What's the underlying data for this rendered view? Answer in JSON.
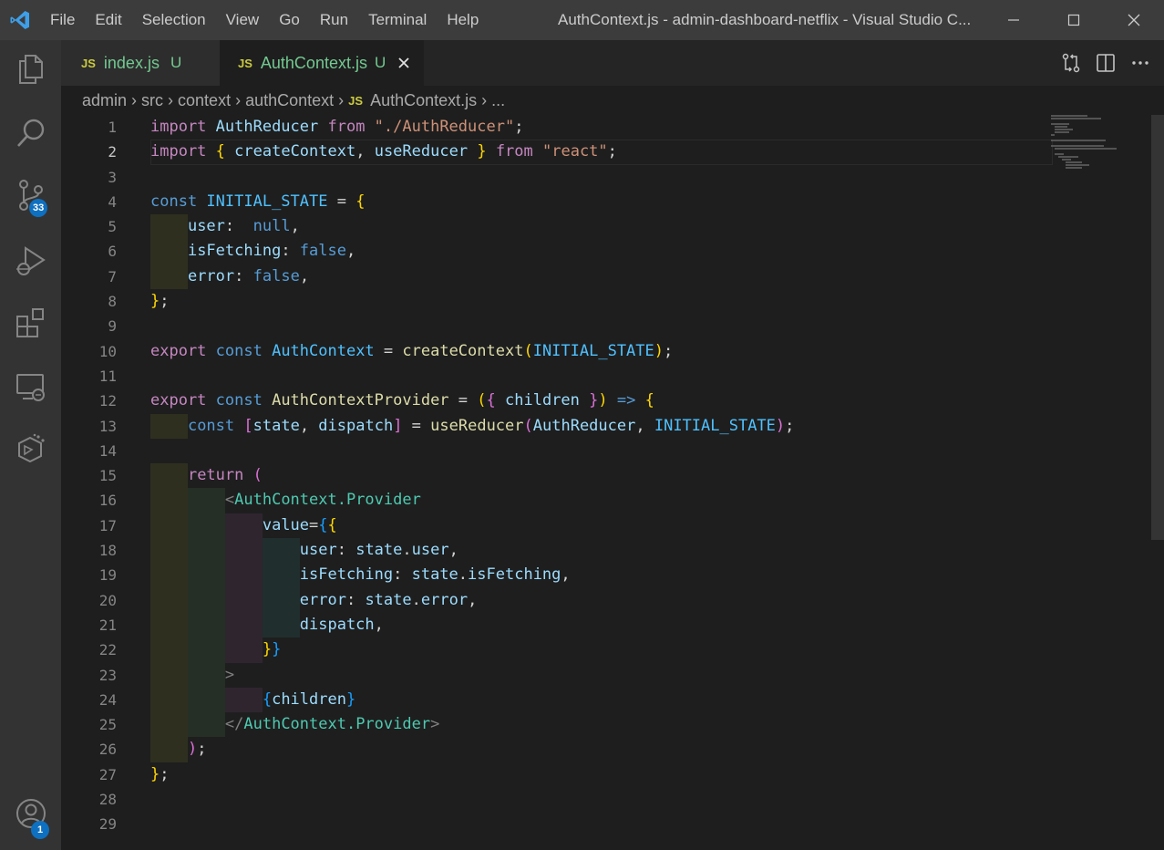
{
  "menu": [
    "File",
    "Edit",
    "Selection",
    "View",
    "Go",
    "Run",
    "Terminal",
    "Help"
  ],
  "window_title": "AuthContext.js - admin-dashboard-netflix - Visual Studio C...",
  "activity": {
    "scm_badge": "33",
    "accounts_badge": "1"
  },
  "tabs": [
    {
      "icon_label": "JS",
      "name": "index.js",
      "status": "U"
    },
    {
      "icon_label": "JS",
      "name": "AuthContext.js",
      "status": "U"
    }
  ],
  "breadcrumb": {
    "parts": [
      "admin",
      "src",
      "context",
      "authContext"
    ],
    "file_icon": "JS",
    "file": "AuthContext.js",
    "trail": "..."
  },
  "editor": {
    "current_line": 2,
    "line_numbers": [
      "1",
      "2",
      "3",
      "4",
      "5",
      "6",
      "7",
      "8",
      "9",
      "10",
      "11",
      "12",
      "13",
      "14",
      "15",
      "16",
      "17",
      "18",
      "19",
      "20",
      "21",
      "22",
      "23",
      "24",
      "25",
      "26",
      "27",
      "28",
      "29"
    ],
    "lines": [
      [
        [
          "kw",
          "import "
        ],
        [
          "var",
          "AuthReducer "
        ],
        [
          "kw",
          "from "
        ],
        [
          "str",
          "\"./AuthReducer\""
        ],
        [
          "punc",
          ";"
        ]
      ],
      [
        [
          "kw",
          "import "
        ],
        [
          "br1",
          "{"
        ],
        [
          "punc",
          " "
        ],
        [
          "var",
          "createContext"
        ],
        [
          "punc",
          ", "
        ],
        [
          "var",
          "useReducer"
        ],
        [
          "punc",
          " "
        ],
        [
          "br1",
          "}"
        ],
        [
          "punc",
          " "
        ],
        [
          "kw",
          "from "
        ],
        [
          "str",
          "\"react\""
        ],
        [
          "punc",
          ";"
        ]
      ],
      [],
      [
        [
          "st",
          "const "
        ],
        [
          "cst",
          "INITIAL_STATE"
        ],
        [
          "punc",
          " = "
        ],
        [
          "br1",
          "{"
        ]
      ],
      [
        [
          "punc",
          "    "
        ],
        [
          "var",
          "user"
        ],
        [
          "punc",
          ":  "
        ],
        [
          "st",
          "null"
        ],
        [
          "punc",
          ","
        ]
      ],
      [
        [
          "punc",
          "    "
        ],
        [
          "var",
          "isFetching"
        ],
        [
          "punc",
          ": "
        ],
        [
          "st",
          "false"
        ],
        [
          "punc",
          ","
        ]
      ],
      [
        [
          "punc",
          "    "
        ],
        [
          "var",
          "error"
        ],
        [
          "punc",
          ": "
        ],
        [
          "st",
          "false"
        ],
        [
          "punc",
          ","
        ]
      ],
      [
        [
          "br1",
          "}"
        ],
        [
          "punc",
          ";"
        ]
      ],
      [],
      [
        [
          "kw",
          "export "
        ],
        [
          "st",
          "const "
        ],
        [
          "cst",
          "AuthContext"
        ],
        [
          "punc",
          " = "
        ],
        [
          "fn",
          "createContext"
        ],
        [
          "br1",
          "("
        ],
        [
          "cst",
          "INITIAL_STATE"
        ],
        [
          "br1",
          ")"
        ],
        [
          "punc",
          ";"
        ]
      ],
      [],
      [
        [
          "kw",
          "export "
        ],
        [
          "st",
          "const "
        ],
        [
          "fn",
          "AuthContextProvider"
        ],
        [
          "punc",
          " = "
        ],
        [
          "br1",
          "("
        ],
        [
          "br2",
          "{"
        ],
        [
          "punc",
          " "
        ],
        [
          "var",
          "children"
        ],
        [
          "punc",
          " "
        ],
        [
          "br2",
          "}"
        ],
        [
          "br1",
          ")"
        ],
        [
          "punc",
          " "
        ],
        [
          "st",
          "=>"
        ],
        [
          "punc",
          " "
        ],
        [
          "br1",
          "{"
        ]
      ],
      [
        [
          "punc",
          "    "
        ],
        [
          "st",
          "const "
        ],
        [
          "br2",
          "["
        ],
        [
          "var",
          "state"
        ],
        [
          "punc",
          ", "
        ],
        [
          "var",
          "dispatch"
        ],
        [
          "br2",
          "]"
        ],
        [
          "punc",
          " = "
        ],
        [
          "fn",
          "useReducer"
        ],
        [
          "br2",
          "("
        ],
        [
          "var",
          "AuthReducer"
        ],
        [
          "punc",
          ", "
        ],
        [
          "cst",
          "INITIAL_STATE"
        ],
        [
          "br2",
          ")"
        ],
        [
          "punc",
          ";"
        ]
      ],
      [],
      [
        [
          "punc",
          "    "
        ],
        [
          "kw",
          "return "
        ],
        [
          "br2",
          "("
        ]
      ],
      [
        [
          "punc",
          "        "
        ],
        [
          "ang",
          "<"
        ],
        [
          "tag",
          "AuthContext.Provider"
        ]
      ],
      [
        [
          "punc",
          "            "
        ],
        [
          "var",
          "value"
        ],
        [
          "punc",
          "="
        ],
        [
          "br3",
          "{"
        ],
        [
          "br1",
          "{"
        ]
      ],
      [
        [
          "punc",
          "                "
        ],
        [
          "var",
          "user"
        ],
        [
          "punc",
          ": "
        ],
        [
          "var",
          "state"
        ],
        [
          "punc",
          "."
        ],
        [
          "var",
          "user"
        ],
        [
          "punc",
          ","
        ]
      ],
      [
        [
          "punc",
          "                "
        ],
        [
          "var",
          "isFetching"
        ],
        [
          "punc",
          ": "
        ],
        [
          "var",
          "state"
        ],
        [
          "punc",
          "."
        ],
        [
          "var",
          "isFetching"
        ],
        [
          "punc",
          ","
        ]
      ],
      [
        [
          "punc",
          "                "
        ],
        [
          "var",
          "error"
        ],
        [
          "punc",
          ": "
        ],
        [
          "var",
          "state"
        ],
        [
          "punc",
          "."
        ],
        [
          "var",
          "error"
        ],
        [
          "punc",
          ","
        ]
      ],
      [
        [
          "punc",
          "                "
        ],
        [
          "var",
          "dispatch"
        ],
        [
          "punc",
          ","
        ]
      ],
      [
        [
          "punc",
          "            "
        ],
        [
          "br1",
          "}"
        ],
        [
          "br3",
          "}"
        ]
      ],
      [
        [
          "punc",
          "        "
        ],
        [
          "ang",
          ">"
        ]
      ],
      [
        [
          "punc",
          "            "
        ],
        [
          "br3",
          "{"
        ],
        [
          "var",
          "children"
        ],
        [
          "br3",
          "}"
        ]
      ],
      [
        [
          "punc",
          "        "
        ],
        [
          "ang",
          "</"
        ],
        [
          "tag",
          "AuthContext.Provider"
        ],
        [
          "ang",
          ">"
        ]
      ],
      [
        [
          "punc",
          "    "
        ],
        [
          "br2",
          ")"
        ],
        [
          "punc",
          ";"
        ]
      ],
      [
        [
          "br1",
          "}"
        ],
        [
          "punc",
          ";"
        ]
      ],
      [],
      []
    ]
  },
  "colors": {
    "titlebar": "#3c3c3c",
    "activitybar": "#333333",
    "editor_bg": "#1e1e1e",
    "badge": "#0e70c0",
    "untracked": "#73c991"
  }
}
